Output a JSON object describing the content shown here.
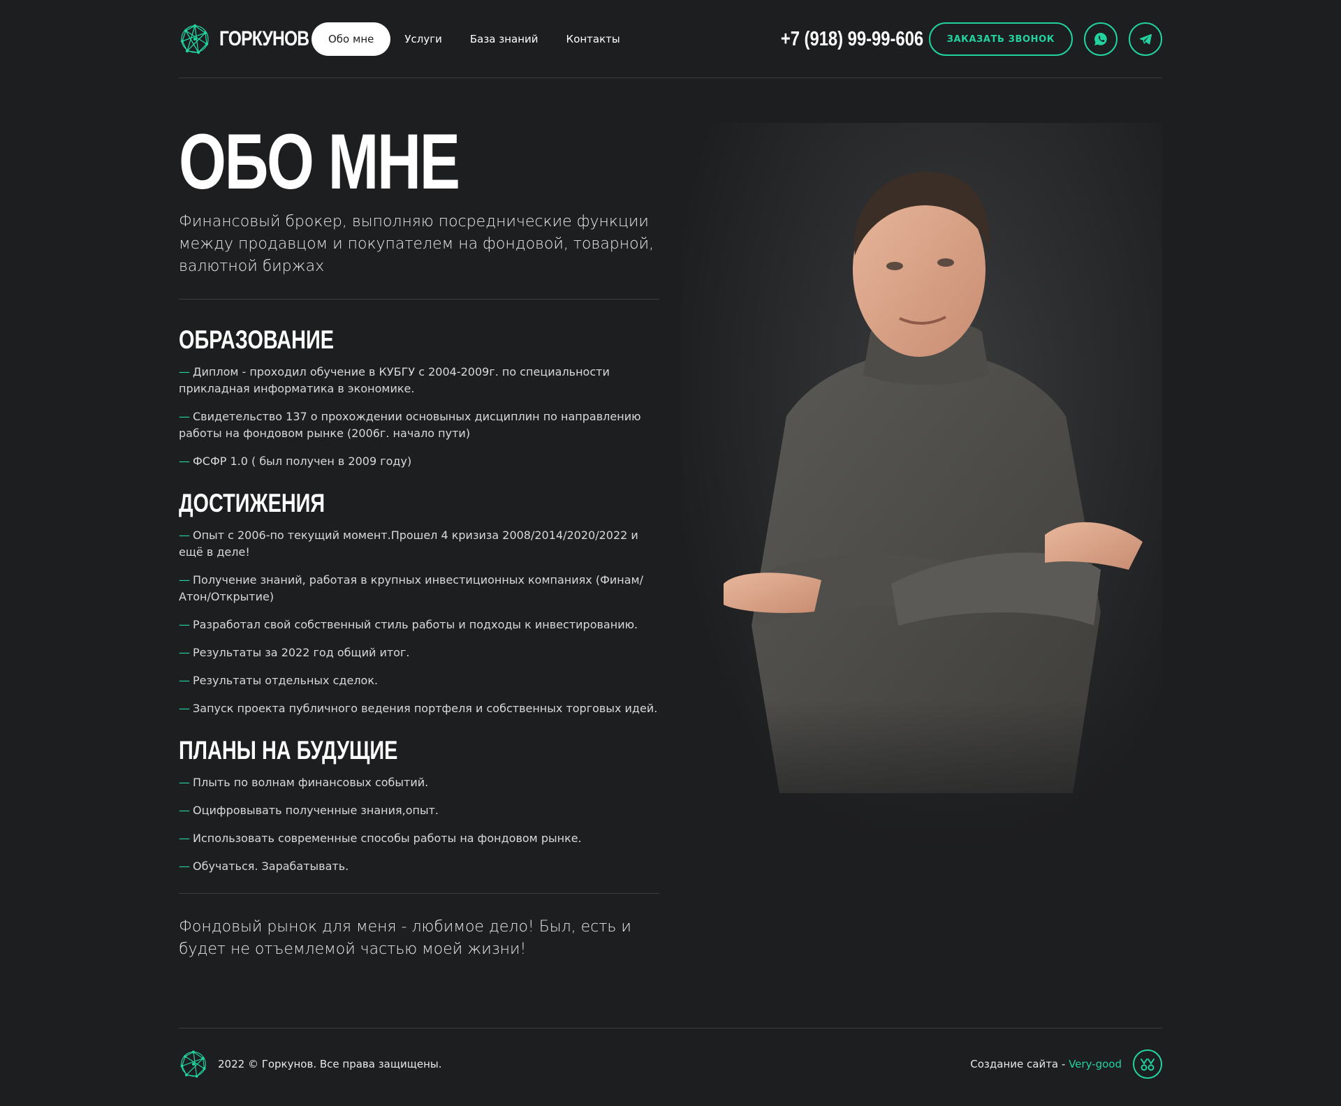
{
  "header": {
    "brand": "ГОРКУНОВ",
    "nav": [
      {
        "label": "Обо мне",
        "active": true
      },
      {
        "label": "Услуги"
      },
      {
        "label": "База знаний"
      },
      {
        "label": "Контакты"
      }
    ],
    "phone": "+7 (918) 99-99-606",
    "callback_label": "ЗАКАЗАТЬ ЗВОНОК",
    "icons": [
      "whatsapp-icon",
      "telegram-icon"
    ]
  },
  "main": {
    "title": "ОБО МНЕ",
    "lead": "Финансовый брокер, выполняю посреднические функции между продавцом и покупателем на фондовой, товарной, валютной биржах",
    "dash": "—",
    "sections": [
      {
        "title": "ОБРАЗОВАНИЕ",
        "items": [
          "Диплом - проходил обучение в КУБГУ с 2004-2009г. по специальности прикладная информатика в экономике.",
          "Свидетельство 137 о прохождении основыных дисциплин по направлению работы на фондовом рынке (2006г. начало пути)",
          "ФСФР 1.0 ( был получен в 2009 году)"
        ]
      },
      {
        "title": "ДОСТИЖЕНИЯ",
        "items": [
          "Опыт с 2006-по текущий момент.Прошел 4 кризиза 2008/2014/2020/2022 и ещё в деле!",
          "Получение знаний, работая в крупных инвестиционных компаниях (Финам/Атон/Открытие)",
          "Разработал свой собственный стиль работы и подходы к инвестированию.",
          "Результаты за 2022 год общий итог.",
          "Результаты отдельных сделок.",
          "Запуск проекта публичного ведения портфеля и собственных торговых идей."
        ]
      },
      {
        "title": "ПЛАНЫ НА БУДУЩИЕ",
        "items": [
          "Плыть по волнам финансовых событий.",
          "Оцифровывать полученные знания,опыт.",
          "Использовать современные способы работы на фондовом рынке.",
          "Обучаться. Зарабатывать."
        ]
      }
    ],
    "closing": "Фондовый рынок для меня - любимое дело! Был, есть и будет не отъемлемой частью моей жизни!"
  },
  "footer": {
    "copyright": "2022 © Горкунов. Все права защищены.",
    "credit_prefix": "Создание сайта - ",
    "credit_link": "Very-good"
  },
  "colors": {
    "background": "#1d1e20",
    "accent": "#22d3a0",
    "text": "#e9e9e9"
  }
}
